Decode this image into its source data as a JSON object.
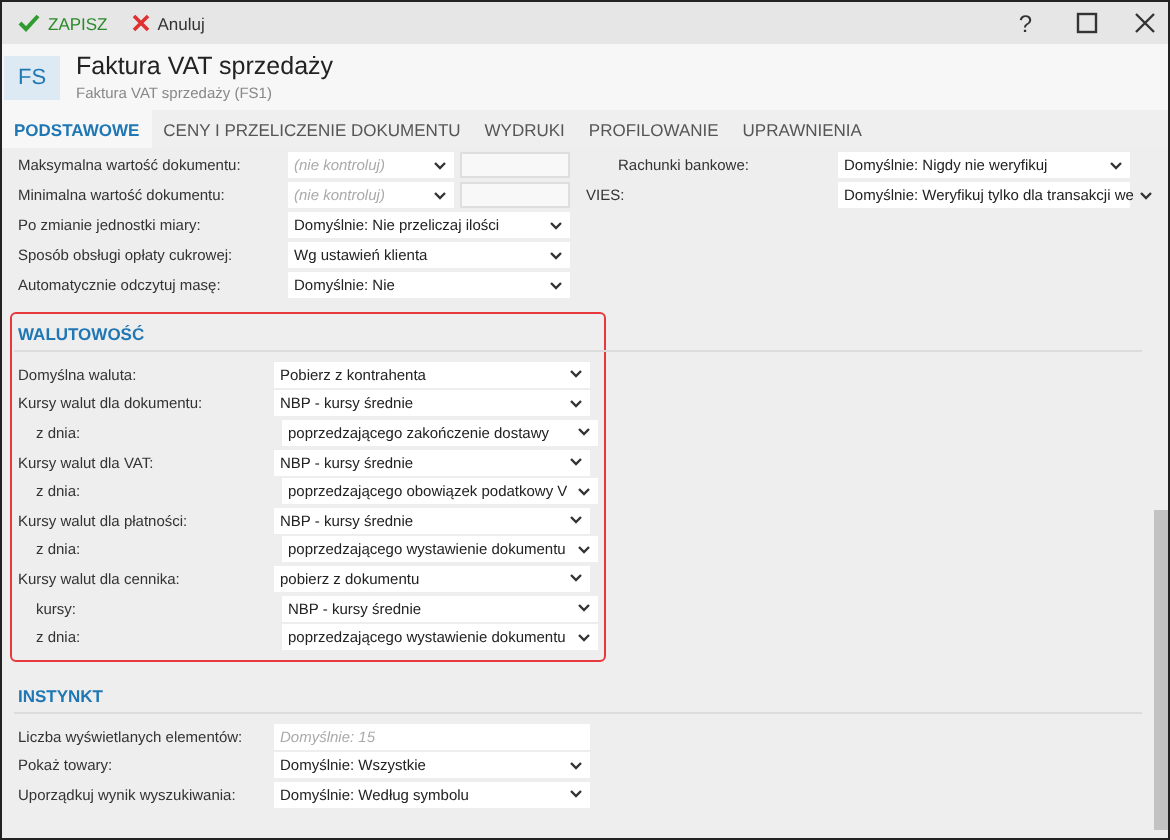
{
  "toolbar": {
    "buttons": [
      {
        "kind": "save",
        "label": "ZAPISZ"
      },
      {
        "kind": "cancel",
        "label": "Anuluj"
      }
    ],
    "help": "?"
  },
  "header": {
    "badge": "FS",
    "title": "Faktura VAT sprzedaży",
    "subtitle": "Faktura VAT sprzedaży (FS1)"
  },
  "tabs": [
    {
      "label": "PODSTAWOWE",
      "selected": true
    },
    {
      "label": "CENY I PRZELICZENIE DOKUMENTU",
      "selected": false
    },
    {
      "label": "WYDRUKI",
      "selected": false
    },
    {
      "label": "PROFILOWANIE",
      "selected": false
    },
    {
      "label": "UPRAWNIENIA",
      "selected": false
    }
  ],
  "general": {
    "left": [
      {
        "kind": "limit",
        "label": "Maksymalna wartość dokumentu:",
        "placeholder": "(nie kontroluj)"
      },
      {
        "kind": "limit",
        "label": "Minimalna wartość dokumentu:",
        "placeholder": "(nie kontroluj)"
      },
      {
        "kind": "select",
        "label": "Po zmianie jednostki miary:",
        "value": "Domyślnie: Nie przeliczaj ilości"
      },
      {
        "kind": "select",
        "label": "Sposób obsługi opłaty cukrowej:",
        "value": "Wg ustawień klienta"
      },
      {
        "kind": "select",
        "label": "Automatycznie odczytuj masę:",
        "value": "Domyślnie: Nie"
      }
    ],
    "right": [
      {
        "kind": "select",
        "label": "Rachunki bankowe:",
        "value": "Domyślnie: Nigdy nie weryfikuj"
      },
      {
        "kind": "select",
        "label": "VIES:",
        "value": "Domyślnie: Weryfikuj tylko dla transakcji we"
      }
    ]
  },
  "sections": [
    {
      "title": "WALUTOWOŚĆ",
      "highlighted": true,
      "rows": [
        {
          "kind": "select",
          "label": "Domyślna waluta:",
          "value": "Pobierz z kontrahenta"
        },
        {
          "kind": "select",
          "label": "Kursy walut dla dokumentu:",
          "value": "NBP - kursy średnie",
          "children": [
            {
              "kind": "select",
              "label": "z dnia:",
              "value": "poprzedzającego zakończenie dostawy"
            }
          ]
        },
        {
          "kind": "select",
          "label": "Kursy walut dla VAT:",
          "value": "NBP - kursy średnie",
          "children": [
            {
              "kind": "select",
              "label": "z dnia:",
              "value": "poprzedzającego obowiązek podatkowy V"
            }
          ]
        },
        {
          "kind": "select",
          "label": "Kursy walut dla płatności:",
          "value": "NBP - kursy średnie",
          "children": [
            {
              "kind": "select",
              "label": "z dnia:",
              "value": "poprzedzającego wystawienie dokumentu"
            }
          ]
        },
        {
          "kind": "select",
          "label": "Kursy walut dla cennika:",
          "value": "pobierz z dokumentu",
          "children": [
            {
              "kind": "select",
              "label": "kursy:",
              "value": "NBP - kursy średnie"
            },
            {
              "kind": "select",
              "label": "z dnia:",
              "value": "poprzedzającego wystawienie dokumentu"
            }
          ]
        }
      ]
    },
    {
      "title": "INSTYNKT",
      "highlighted": false,
      "rows": [
        {
          "kind": "input",
          "label": "Liczba wyświetlanych elementów:",
          "placeholder": "Domyślnie: 15"
        },
        {
          "kind": "select",
          "label": "Pokaż towary:",
          "value": "Domyślnie: Wszystkie"
        },
        {
          "kind": "select",
          "label": "Uporządkuj wynik wyszukiwania:",
          "value": "Domyślnie: Według symbolu"
        }
      ]
    }
  ]
}
